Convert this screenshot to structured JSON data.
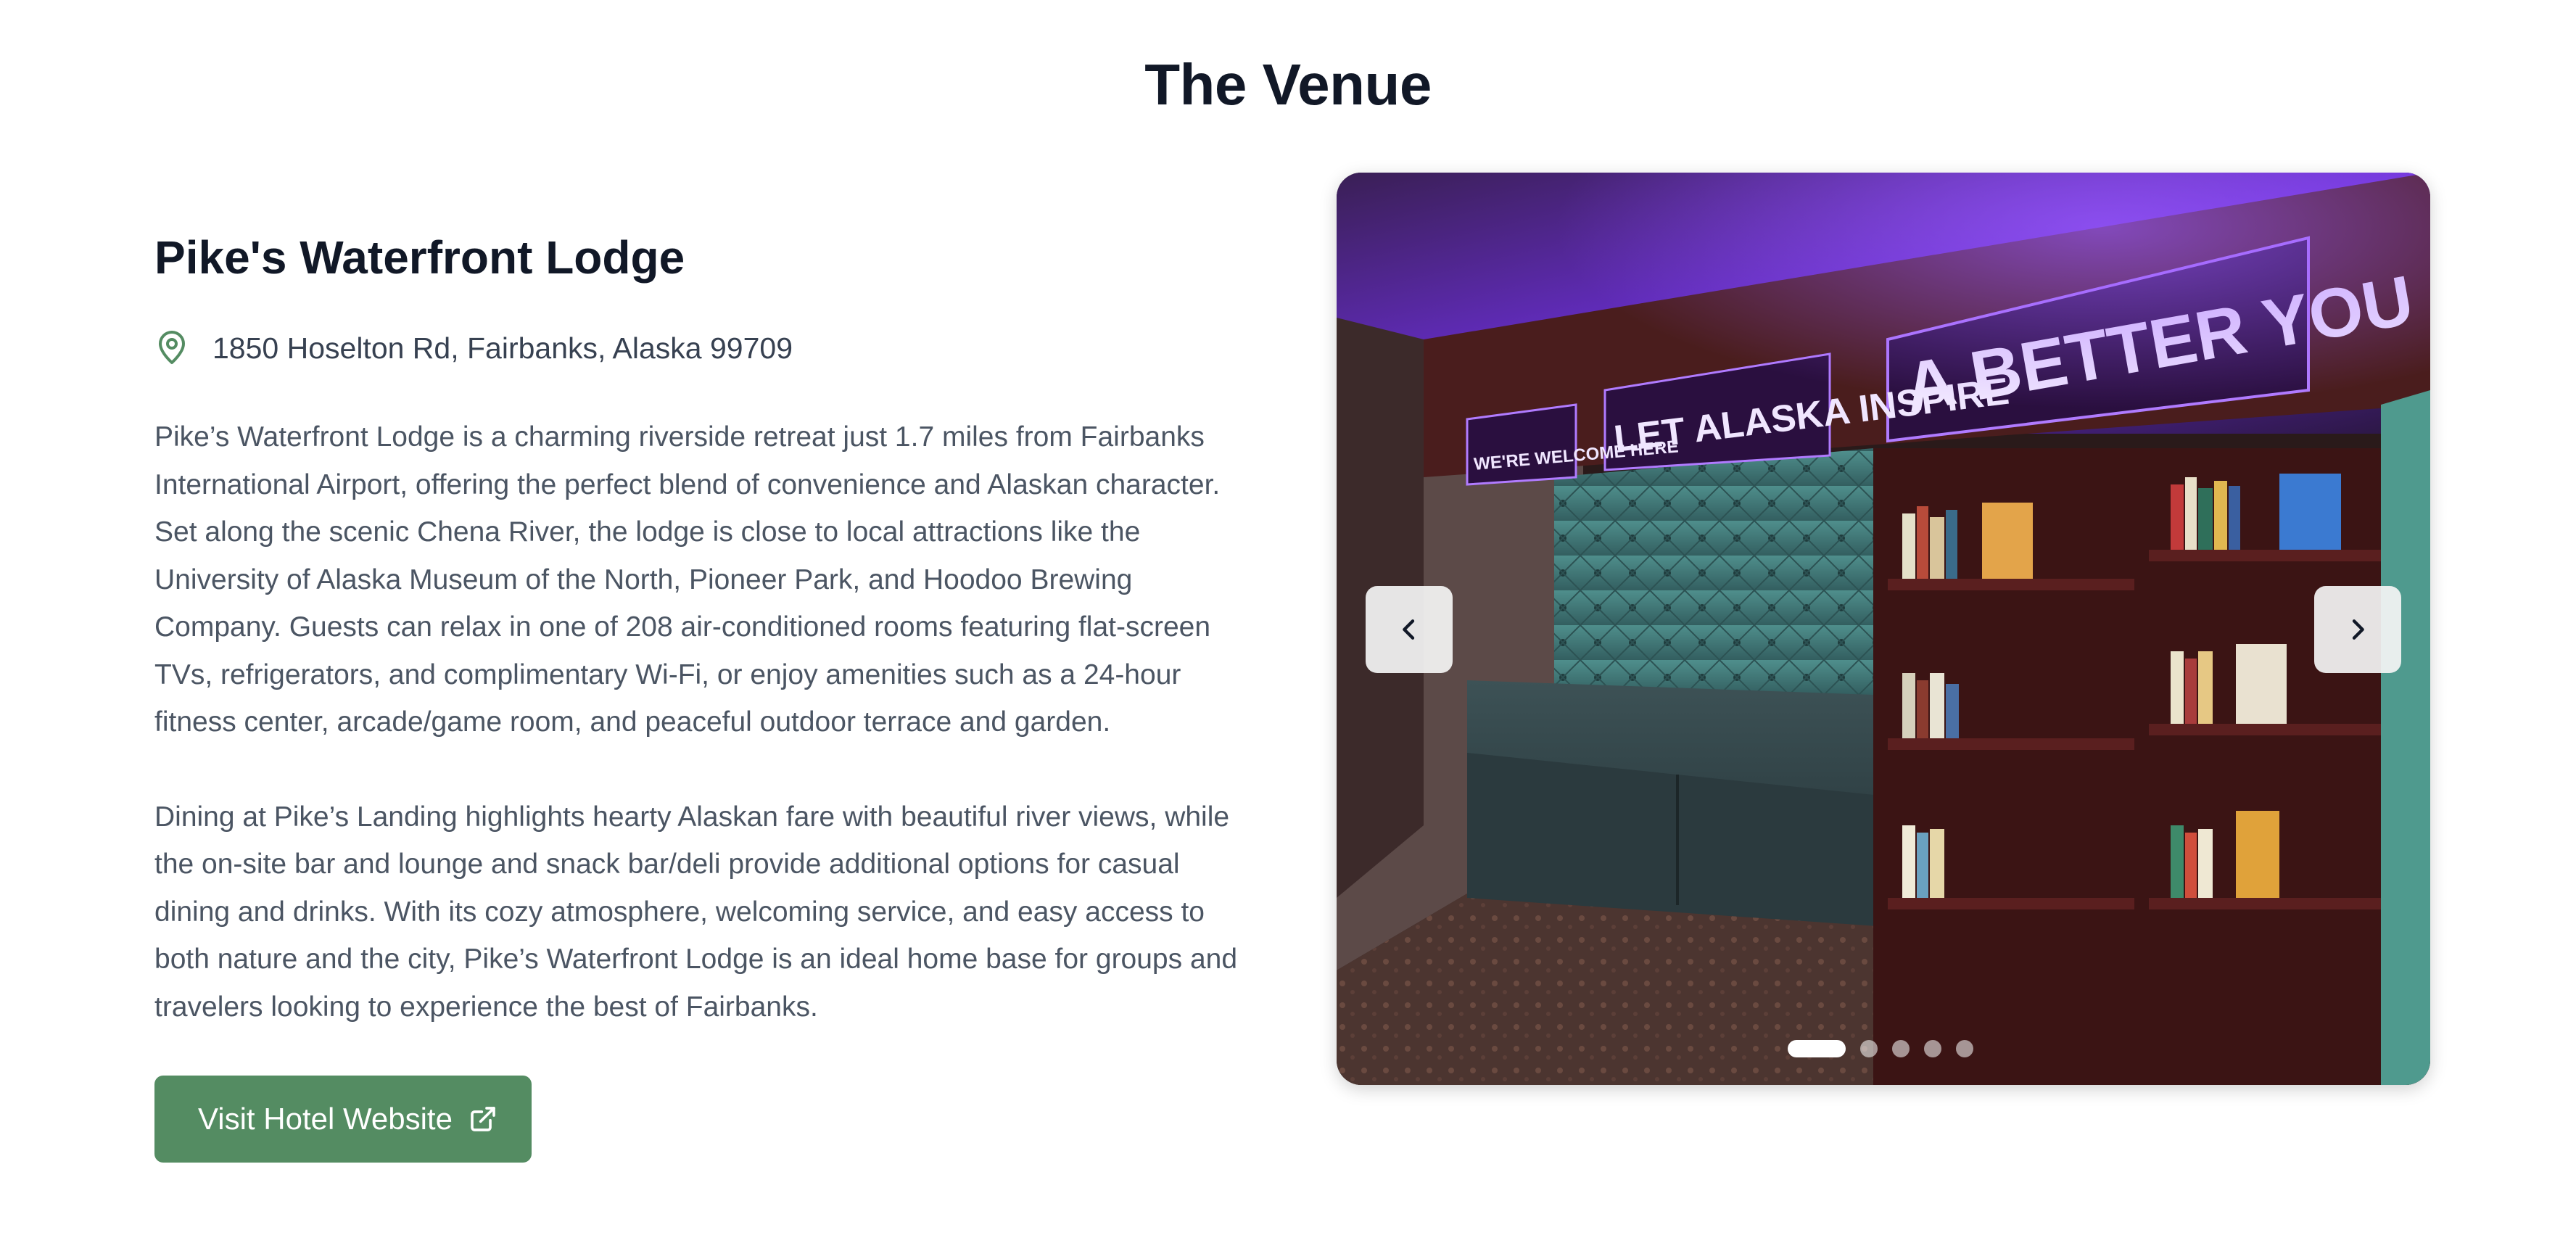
{
  "section": {
    "title": "The Venue"
  },
  "venue": {
    "name": "Pike's Waterfront Lodge",
    "address": "1850 Hoselton Rd, Fairbanks, Alaska 99709",
    "description_1": "Pike’s Waterfront Lodge is a charming riverside retreat just 1.7 miles from Fairbanks International Airport, offering the perfect blend of convenience and Alaskan character. Set along the scenic Chena River, the lodge is close to local attractions like the University of Alaska Museum of the North, Pioneer Park, and Hoodoo Brewing Company. Guests can relax in one of 208 air-conditioned rooms featuring flat-screen TVs, refrigerators, and complimentary Wi-Fi, or enjoy amenities such as a 24-hour fitness center, arcade/game room, and peaceful outdoor terrace and garden.",
    "description_2": "Dining at Pike’s Landing highlights hearty Alaskan fare with beautiful river views, while the on-site bar and lounge and snack bar/deli provide additional options for casual dining and drinks. With its cozy atmosphere, welcoming service, and easy access to both nature and the city, Pike’s Waterfront Lodge is an ideal home base for groups and travelers looking to experience the best of Fairbanks.",
    "website_button": "Visit Hotel Website"
  },
  "carousel": {
    "photo_signs": [
      "A BETTER YOU",
      "LET ALASKA INSPIRE",
      "WE'RE WELCOME HERE"
    ],
    "slide_count": 5,
    "active_slide": 1,
    "icons": {
      "prev": "chevron-left-icon",
      "next": "chevron-right-icon"
    }
  },
  "colors": {
    "accent": "#548c62",
    "neon": "#8a3cff"
  }
}
